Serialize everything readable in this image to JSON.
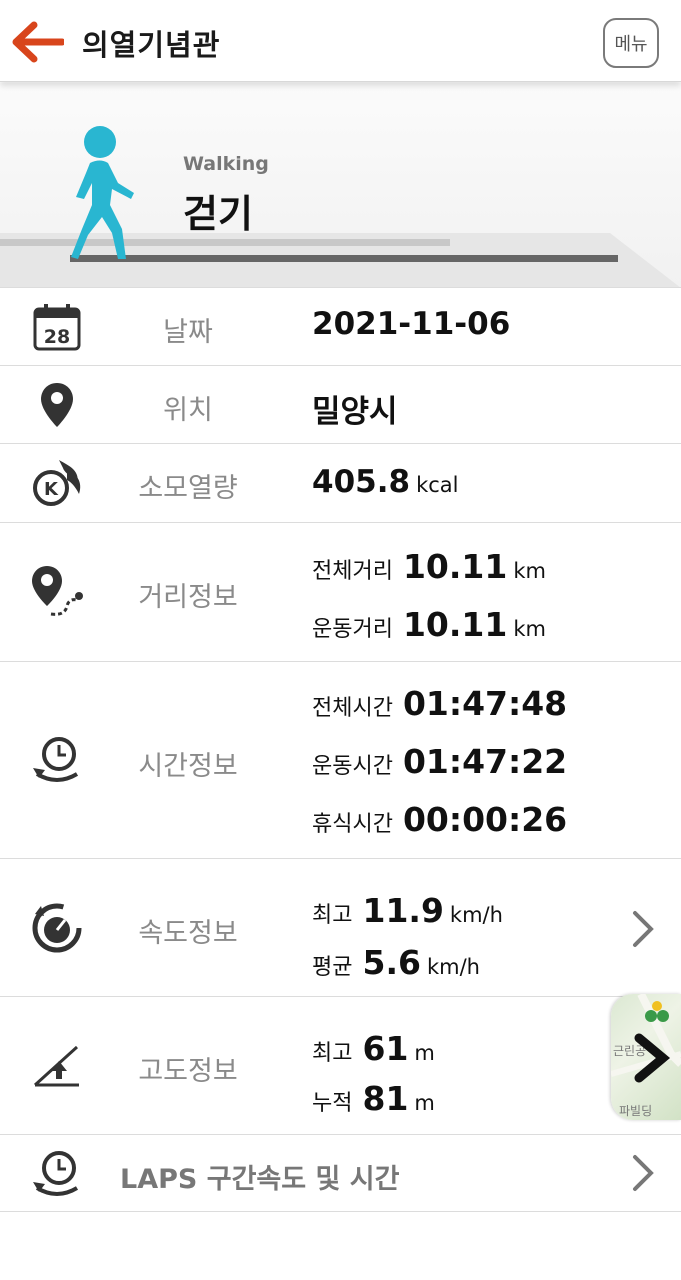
{
  "header": {
    "title": "의열기념관",
    "menu_label": "메뉴"
  },
  "activity": {
    "name_en": "Walking",
    "name_ko": "걷기"
  },
  "date": {
    "label": "날짜",
    "value": "2021-11-06",
    "calendar_day": "28"
  },
  "location": {
    "label": "위치",
    "value": "밀양시"
  },
  "calories": {
    "label": "소모열량",
    "value": "405.8",
    "unit": "kcal"
  },
  "distance": {
    "label": "거리정보",
    "total_label": "전체거리",
    "total_value": "10.11",
    "total_unit": "km",
    "exercise_label": "운동거리",
    "exercise_value": "10.11",
    "exercise_unit": "km"
  },
  "time": {
    "label": "시간정보",
    "total_label": "전체시간",
    "total_value": "01:47:48",
    "exercise_label": "운동시간",
    "exercise_value": "01:47:22",
    "rest_label": "휴식시간",
    "rest_value": "00:00:26"
  },
  "speed": {
    "label": "속도정보",
    "max_label": "최고",
    "max_value": "11.9",
    "max_unit": "km/h",
    "avg_label": "평균",
    "avg_value": "5.6",
    "avg_unit": "km/h"
  },
  "altitude": {
    "label": "고도정보",
    "max_label": "최고",
    "max_value": "61",
    "max_unit": "m",
    "cum_label": "누적",
    "cum_value": "81",
    "cum_unit": "m"
  },
  "laps": {
    "label": "LAPS 구간속도 및 시간"
  },
  "map": {
    "text_1": "근린공",
    "text_2": "파빌딩"
  },
  "colors": {
    "accent": "#d8451c",
    "walker": "#29b6d1",
    "icon": "#333333",
    "label": "#8a8a8a"
  }
}
